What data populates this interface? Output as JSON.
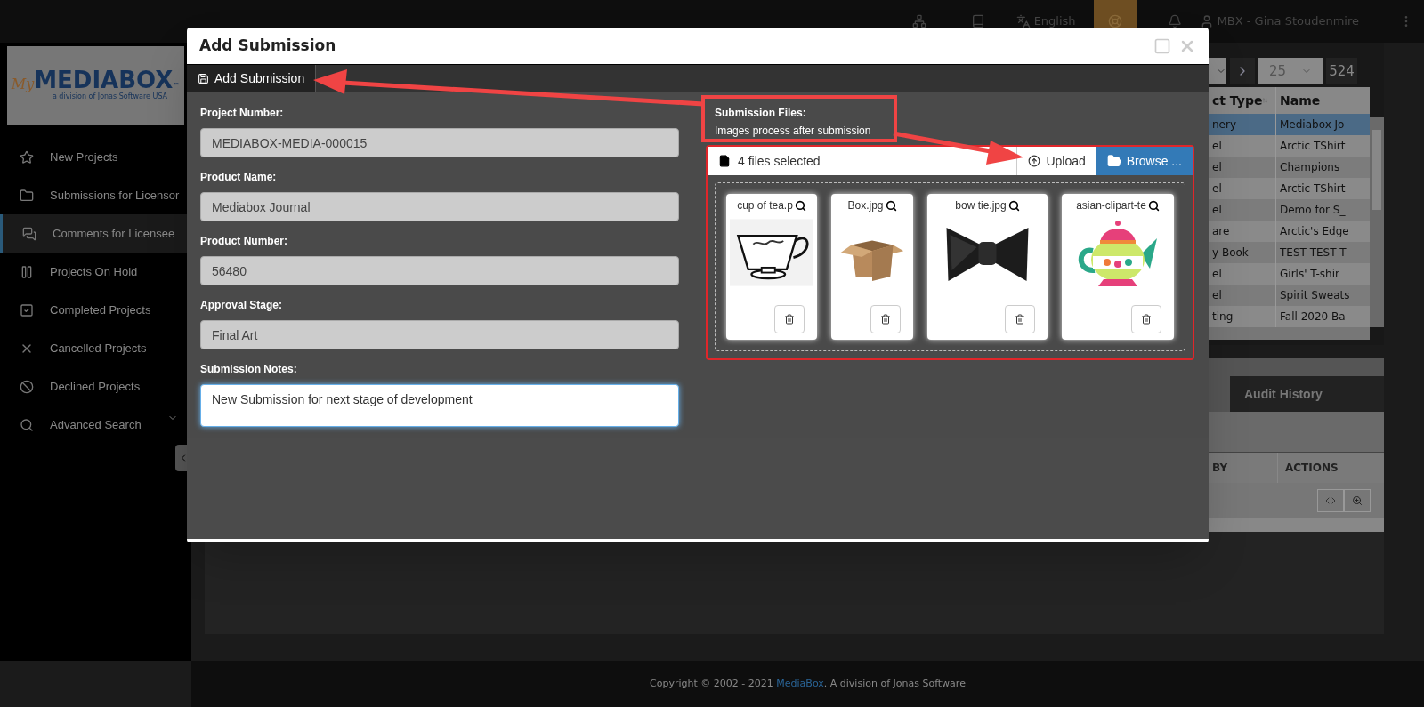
{
  "top_bar": {
    "language": "English",
    "user": "MBX - Gina Stoudenmire"
  },
  "logo": {
    "script": "My",
    "name": "MEDIABOX",
    "mark": "™",
    "tagline": "a division of Jonas Software USA"
  },
  "sidebar": {
    "items": [
      {
        "label": "New Projects",
        "kind": "star",
        "selected": false,
        "expandable": false
      },
      {
        "label": "Submissions for Licensor",
        "kind": "folder",
        "selected": false,
        "expandable": false
      },
      {
        "label": "Comments for Licensee",
        "kind": "comments",
        "selected": true,
        "expandable": false
      },
      {
        "label": "Projects On Hold",
        "kind": "pause",
        "selected": false,
        "expandable": false
      },
      {
        "label": "Completed Projects",
        "kind": "check",
        "selected": false,
        "expandable": false
      },
      {
        "label": "Cancelled Projects",
        "kind": "times",
        "selected": false,
        "expandable": false
      },
      {
        "label": "Declined Projects",
        "kind": "ban",
        "selected": false,
        "expandable": false
      },
      {
        "label": "Advanced Search",
        "kind": "search",
        "selected": false,
        "expandable": true
      }
    ]
  },
  "background_table": {
    "pager": {
      "page_size": "25",
      "total": "524"
    },
    "columns": [
      "ct Type",
      "Name"
    ],
    "rows": [
      {
        "cells": [
          "nery",
          "Mediabox Jo"
        ],
        "selected": true
      },
      {
        "cells": [
          "el",
          "Arctic TShirt"
        ],
        "selected": false
      },
      {
        "cells": [
          "el",
          "Champions"
        ],
        "selected": false
      },
      {
        "cells": [
          "el",
          "Arctic TShirt"
        ],
        "selected": false
      },
      {
        "cells": [
          "el",
          "Demo for S_"
        ],
        "selected": false
      },
      {
        "cells": [
          "are",
          "Arctic's Edge"
        ],
        "selected": false
      },
      {
        "cells": [
          "y Book",
          "TEST TEST T"
        ],
        "selected": false
      },
      {
        "cells": [
          "el",
          "Girls' T-shir"
        ],
        "selected": false
      },
      {
        "cells": [
          "el",
          "Spirit Sweats"
        ],
        "selected": false
      },
      {
        "cells": [
          "ting",
          "Fall 2020 Ba"
        ],
        "selected": false
      }
    ]
  },
  "background_tabs": [
    {
      "label": "Audit History"
    }
  ],
  "background_grid": {
    "columns": [
      "BY",
      "ACTIONS"
    ]
  },
  "modal": {
    "title": "Add Submission",
    "toolbar": [
      {
        "label": "Add Submission"
      }
    ],
    "fields": [
      {
        "label": "Project Number:",
        "value": "MEDIABOX-MEDIA-000015",
        "kind": "input",
        "disabled": true
      },
      {
        "label": "Product Name:",
        "value": "Mediabox Journal",
        "kind": "input",
        "disabled": true
      },
      {
        "label": "Product Number:",
        "value": "56480",
        "kind": "input",
        "disabled": true
      },
      {
        "label": "Approval Stage:",
        "value": "Final Art",
        "kind": "input",
        "disabled": true
      },
      {
        "label": "Submission Notes:",
        "value": "New Submission for next stage of development",
        "kind": "textarea",
        "disabled": false
      }
    ],
    "files": {
      "label": "Submission Files:",
      "hint": "Images process after submission",
      "caption": "4 files selected",
      "upload": "Upload",
      "browse": "Browse ...",
      "items": [
        {
          "name": "cup of tea.p",
          "kind": "picture"
        },
        {
          "name": "Box.jpg",
          "kind": "picture"
        },
        {
          "name": "bow tie.jpg",
          "kind": "picture"
        },
        {
          "name": "asian-clipart-te",
          "kind": "picture"
        }
      ]
    }
  },
  "footer": {
    "prefix": "Copyright © 2002 - 2021",
    "link": "MediaBox",
    "suffix": ". A division of Jonas Software"
  }
}
